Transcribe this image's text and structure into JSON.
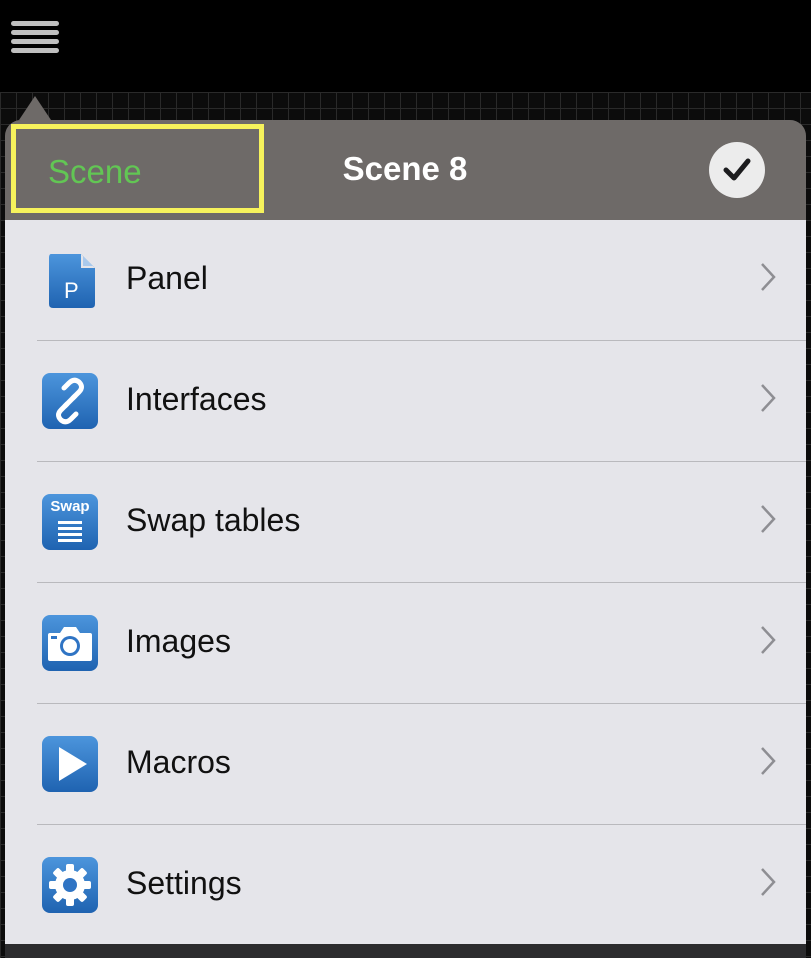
{
  "header": {
    "back_label": "Scene",
    "title": "Scene 8"
  },
  "menu": {
    "items": [
      {
        "label": "Panel",
        "icon": "panel-icon"
      },
      {
        "label": "Interfaces",
        "icon": "link-icon"
      },
      {
        "label": "Swap tables",
        "icon": "swap-tables-icon",
        "icon_text": "Swap"
      },
      {
        "label": "Images",
        "icon": "camera-icon"
      },
      {
        "label": "Macros",
        "icon": "play-icon"
      },
      {
        "label": "Settings",
        "icon": "gear-icon"
      }
    ]
  },
  "colors": {
    "header_bg": "#6e6a68",
    "back_text": "#62c654",
    "highlight_border": "#f6f25c",
    "menu_bg": "#e5e5ea",
    "icon_blue": "#2f74c4"
  }
}
